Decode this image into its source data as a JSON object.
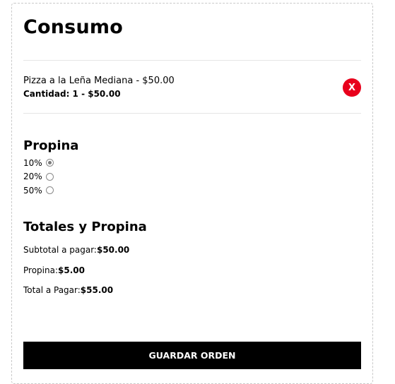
{
  "consumo": {
    "title": "Consumo",
    "items": [
      {
        "name": "Pizza a la Leña Mediana - $50.00",
        "quantity_line": "Cantidad: 1 - $50.00",
        "remove_label": "X"
      }
    ]
  },
  "propina": {
    "heading": "Propina",
    "options": [
      {
        "label": "10%",
        "checked": true
      },
      {
        "label": "20%",
        "checked": false
      },
      {
        "label": "50%",
        "checked": false
      }
    ]
  },
  "totales": {
    "heading": "Totales y Propina",
    "subtotal_label": "Subtotal a pagar:",
    "subtotal_value": "$50.00",
    "propina_label": "Propina:",
    "propina_value": "$5.00",
    "total_label": "Total a Pagar:",
    "total_value": "$55.00"
  },
  "actions": {
    "save_label": "GUARDAR ORDEN"
  },
  "colors": {
    "remove_button": "#e8001c",
    "save_button": "#000000",
    "card_border": "#c9c9c9"
  }
}
